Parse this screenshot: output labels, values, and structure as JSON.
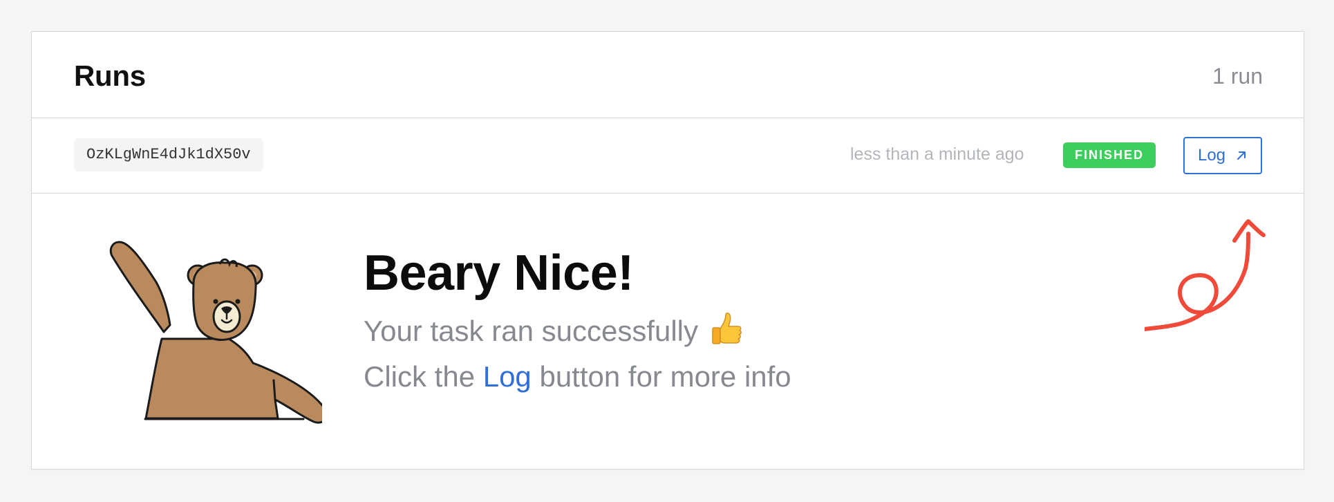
{
  "header": {
    "title": "Runs",
    "count": "1 run"
  },
  "run": {
    "id": "OzKLgWnE4dJk1dX50v",
    "time": "less than a minute ago",
    "status": "FINISHED",
    "log_label": "Log"
  },
  "message": {
    "heading": "Beary Nice!",
    "line1": "Your task ran successfully",
    "line2_prefix": "Click the ",
    "line2_link": "Log",
    "line2_suffix": " button for more info"
  },
  "colors": {
    "badge": "#3ece5d",
    "link": "#2f6fd6",
    "arrow": "#f04a3a",
    "bear": "#b98a5e"
  },
  "icons": [
    "external-arrow-icon",
    "thumbs-up-icon",
    "bear-illustration",
    "curly-arrow-icon"
  ]
}
